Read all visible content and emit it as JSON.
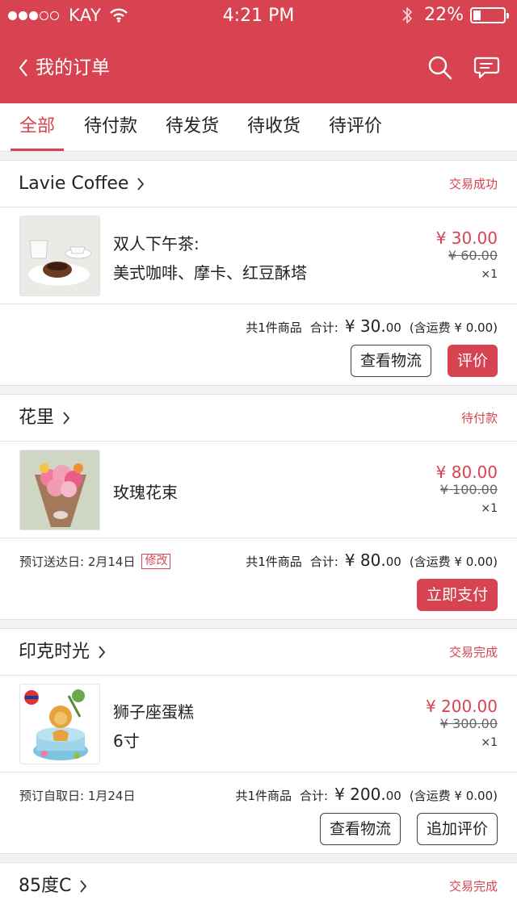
{
  "status_bar": {
    "carrier": "KAY",
    "time": "4:21 PM",
    "battery_pct": "22%",
    "signal_bars": 3,
    "battery_level": 0.22
  },
  "nav": {
    "title": "我的订单",
    "back_icon": "chevron-left-icon",
    "search_icon": "search-icon",
    "message_icon": "chat-bubble-icon"
  },
  "tabs": [
    "全部",
    "待付款",
    "待发货",
    "待收货",
    "待评价"
  ],
  "active_tab": "全部",
  "colors": {
    "accent": "#d84352",
    "background": "#f2f2f2"
  },
  "orders": [
    {
      "shop": "Lavie Coffee",
      "status": "交易成功",
      "item_title_1": "双人下午茶:",
      "item_title_2": "美式咖啡、摩卡、红豆酥塔",
      "price": "¥ 30.00",
      "original_price": "¥ 60.00",
      "qty": "×1",
      "count_label": "共1件商品",
      "total_label": "合计:",
      "total_big": "¥ 30.",
      "total_small": "00",
      "shipping": "(含运费 ¥ 0.00)",
      "buttons": [
        "查看物流",
        "评价"
      ]
    },
    {
      "shop": "花里",
      "status": "待付款",
      "item_title_1": "玫瑰花束",
      "price": "¥ 80.00",
      "original_price": "¥ 100.00",
      "qty": "×1",
      "date_note": "预订送达日: 2月14日",
      "edit_label": "修改",
      "count_label": "共1件商品",
      "total_label": "合计:",
      "total_big": "¥ 80.",
      "total_small": "00",
      "shipping": "(含运费 ¥ 0.00)",
      "buttons": [
        "立即支付"
      ]
    },
    {
      "shop": "印克时光",
      "status": "交易完成",
      "item_title_1": "狮子座蛋糕",
      "item_title_2": "6寸",
      "price": "¥ 200.00",
      "original_price": "¥ 300.00",
      "qty": "×1",
      "date_note": "预订自取日: 1月24日",
      "count_label": "共1件商品",
      "total_label": "合计:",
      "total_big": "¥ 200.",
      "total_small": "00",
      "shipping": "(含运费 ¥ 0.00)",
      "buttons": [
        "查看物流",
        "追加评价"
      ]
    },
    {
      "shop": "85度C",
      "status": "交易完成"
    }
  ]
}
